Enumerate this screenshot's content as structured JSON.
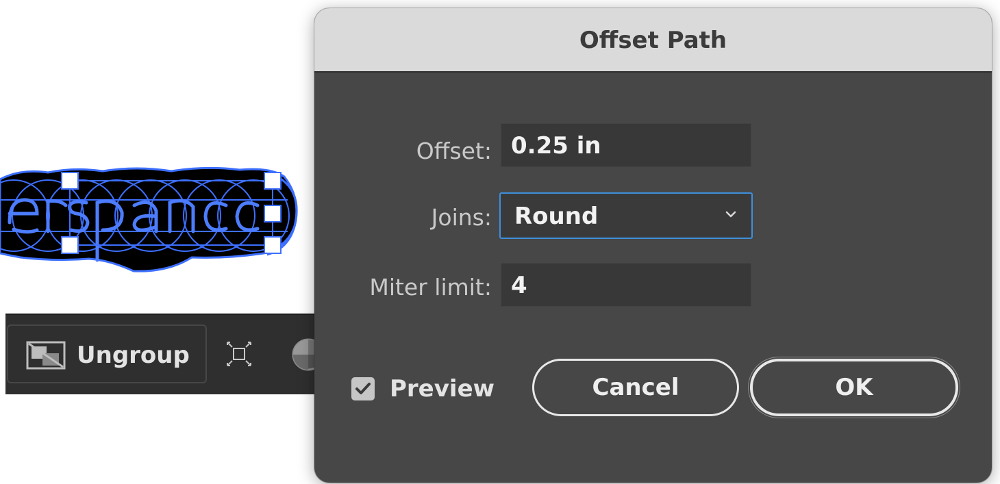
{
  "dialog": {
    "title": "Offset Path",
    "fields": {
      "offset": {
        "label": "Offset:",
        "value": "0.25 in"
      },
      "joins": {
        "label": "Joins:",
        "value": "Round"
      },
      "miter_limit": {
        "label": "Miter limit:",
        "value": "4"
      }
    },
    "preview": {
      "label": "Preview",
      "checked": true
    },
    "buttons": {
      "cancel": "Cancel",
      "ok": "OK"
    }
  },
  "taskbar": {
    "ungroup_label": "Ungroup",
    "icons": [
      "ungroup-icon",
      "transform-icon",
      "color-wheel-icon"
    ]
  },
  "colors": {
    "dialog_bg": "#474747",
    "titlebar_bg": "#dadada",
    "focus_ring": "#3f8fdc",
    "selection_blue": "#3d6fff",
    "taskbar_bg": "#2f2f2f"
  }
}
